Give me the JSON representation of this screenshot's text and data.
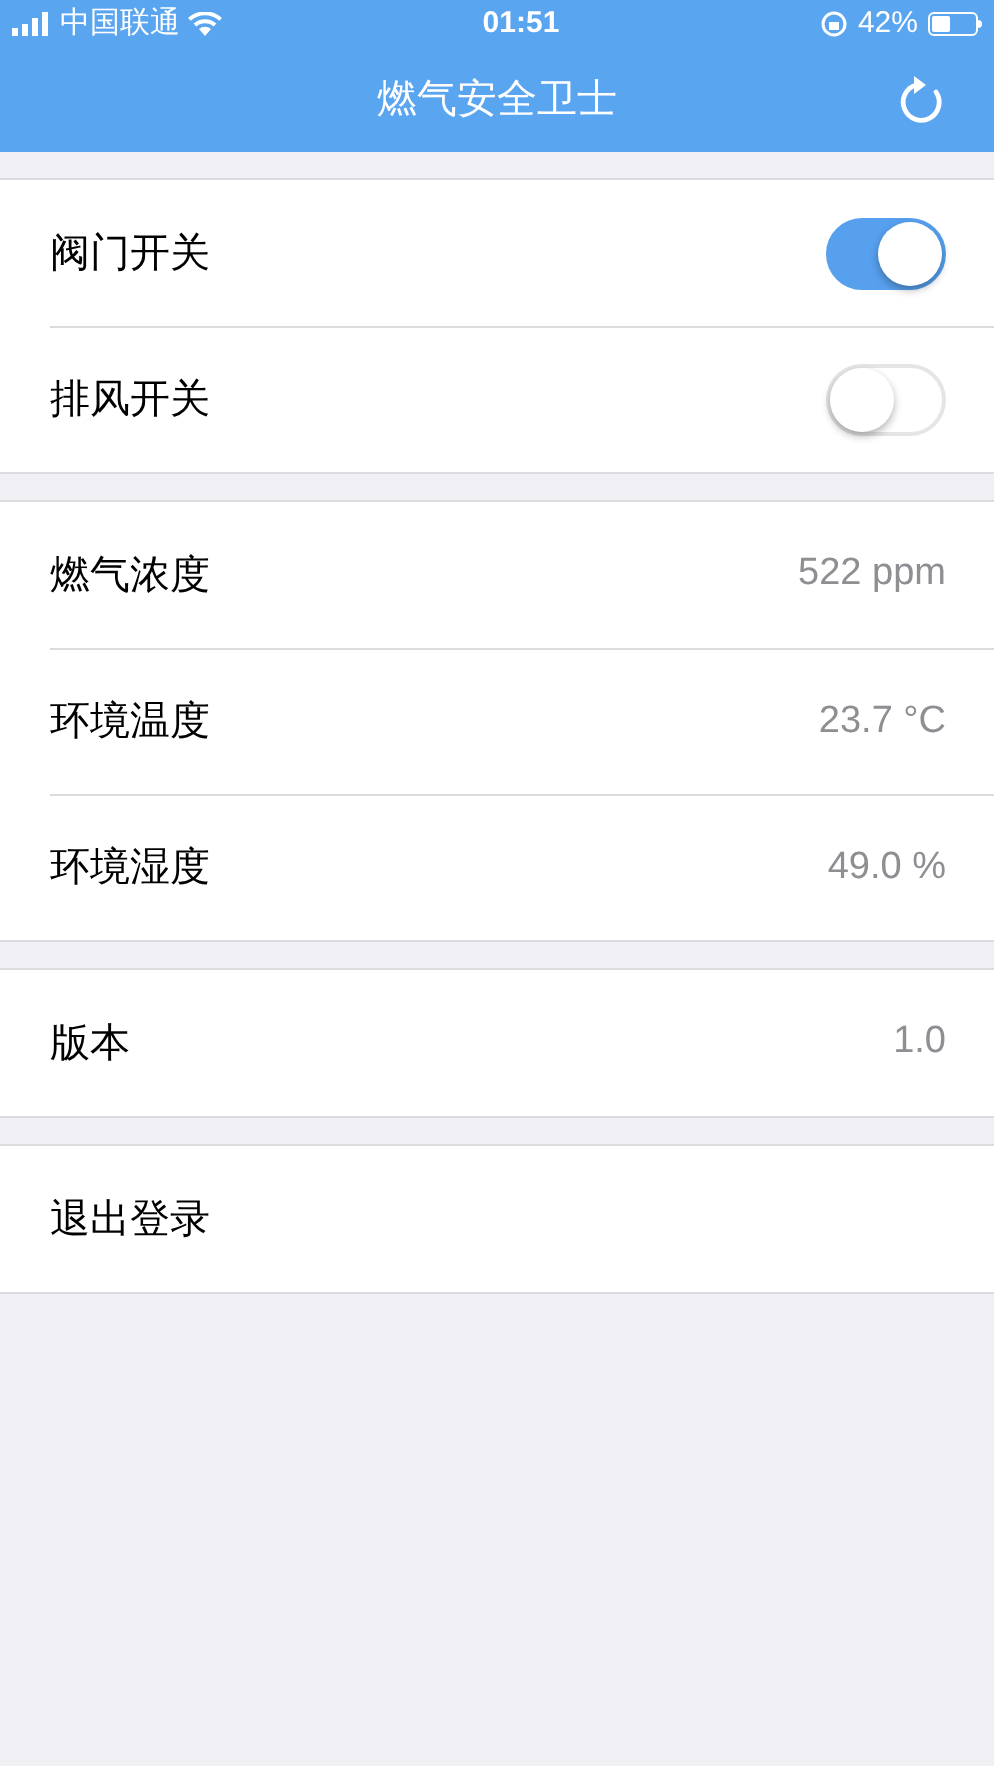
{
  "status_bar": {
    "carrier": "中国联通",
    "time": "01:51",
    "battery": "42%"
  },
  "nav": {
    "title": "燃气安全卫士"
  },
  "sections": [
    {
      "rows": [
        {
          "kind": "switch",
          "label": "阀门开关",
          "on": true
        },
        {
          "kind": "switch",
          "label": "排风开关",
          "on": false
        }
      ]
    },
    {
      "rows": [
        {
          "kind": "value",
          "label": "燃气浓度",
          "value": "522 ppm"
        },
        {
          "kind": "value",
          "label": "环境温度",
          "value": "23.7 °C"
        },
        {
          "kind": "value",
          "label": "环境湿度",
          "value": "49.0 %"
        }
      ]
    },
    {
      "rows": [
        {
          "kind": "value",
          "label": "版本",
          "value": "1.0"
        }
      ]
    },
    {
      "rows": [
        {
          "kind": "action",
          "label": "退出登录"
        }
      ]
    }
  ]
}
